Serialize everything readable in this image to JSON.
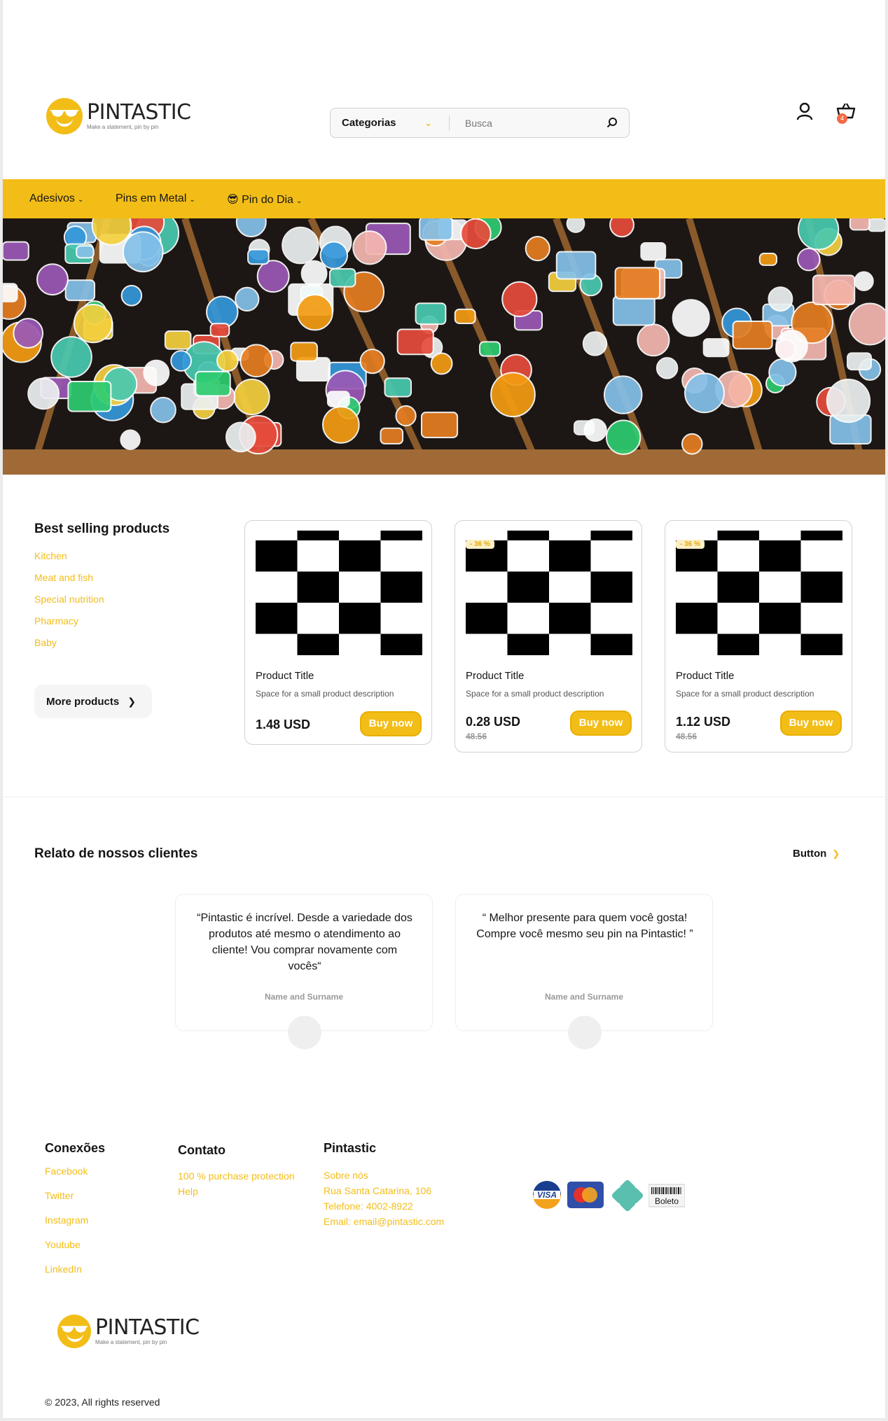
{
  "brand": {
    "name": "PINTASTIC",
    "tagline": "Make a statement, pin by pin"
  },
  "header": {
    "category_label": "Categorias",
    "search_placeholder": "Busca",
    "cart_count": "4"
  },
  "nav": {
    "items": [
      {
        "label": "Adesivos"
      },
      {
        "label": "Pins em Metal"
      },
      {
        "label": "😎 Pin do Dia"
      }
    ]
  },
  "best_selling": {
    "title": "Best selling products",
    "categories": [
      "Kitchen",
      "Meat and fish",
      "Special nutrition",
      "Pharmacy",
      "Baby"
    ],
    "more_label": "More products",
    "products": [
      {
        "title": "Product Title",
        "description": "Space for a small product description",
        "price": "1.48 USD",
        "old_price": "",
        "discount": "",
        "buy": "Buy now"
      },
      {
        "title": "Product Title",
        "description": "Space for a small product description",
        "price": "0.28 USD",
        "old_price": "48.56",
        "discount": "- 36 %",
        "buy": "Buy now"
      },
      {
        "title": "Product Title",
        "description": "Space for a small product description",
        "price": "1.12 USD",
        "old_price": "48.56",
        "discount": "- 36 %",
        "buy": "Buy now"
      }
    ]
  },
  "testimonials": {
    "title": "Relato de nossos clientes",
    "button": "Button",
    "items": [
      {
        "quote": "“Pintastic é incrível. Desde a variedade dos produtos até mesmo o atendimento ao cliente! Vou comprar novamente com vocês“",
        "name": "Name and Surname"
      },
      {
        "quote": "“ Melhor presente para quem você gosta! Compre você mesmo seu pin na Pintastic! ”",
        "name": "Name and Surname"
      }
    ]
  },
  "footer": {
    "connections": {
      "title": "Conexões",
      "links": [
        "Facebook",
        "Twitter",
        "Instagram",
        "Youtube",
        "LinkedIn"
      ]
    },
    "contact": {
      "title": "Contato",
      "links": [
        "100 % purchase protection",
        "Help"
      ]
    },
    "pintastic": {
      "title": "Pintastic",
      "links": [
        "Sobre nós",
        "Rua Santa Catarina, 106",
        "Telefone: 4002-8922",
        "Email: email@pintastic.com"
      ]
    },
    "payments": [
      "VISA",
      "Mastercard",
      "Pix",
      "Boleto"
    ],
    "copyright": "© 2023, All rights reserved"
  },
  "colors": {
    "accent": "#F3BD17",
    "badge": "#F36B45",
    "text": "#151515"
  }
}
